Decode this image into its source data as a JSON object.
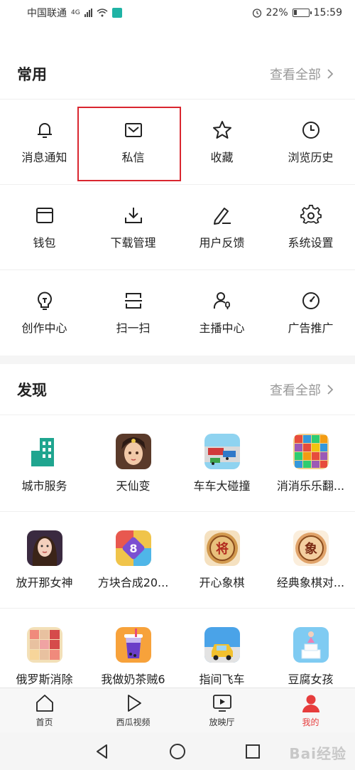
{
  "status_bar": {
    "carrier": "中国联通",
    "network": "4G",
    "battery": "22%",
    "battery_fraction": 0.22,
    "time": "15:59"
  },
  "common": {
    "title": "常用",
    "see_all": "查看全部",
    "rows": [
      [
        {
          "label": "消息通知",
          "icon": "bell-icon"
        },
        {
          "label": "私信",
          "icon": "mail-icon"
        },
        {
          "label": "收藏",
          "icon": "star-icon"
        },
        {
          "label": "浏览历史",
          "icon": "clock-icon"
        }
      ],
      [
        {
          "label": "钱包",
          "icon": "wallet-icon"
        },
        {
          "label": "下载管理",
          "icon": "download-icon"
        },
        {
          "label": "用户反馈",
          "icon": "pen-icon"
        },
        {
          "label": "系统设置",
          "icon": "gear-icon"
        }
      ],
      [
        {
          "label": "创作中心",
          "icon": "bulb-icon"
        },
        {
          "label": "扫一扫",
          "icon": "scan-icon"
        },
        {
          "label": "主播中心",
          "icon": "anchor-user-icon"
        },
        {
          "label": "广告推广",
          "icon": "gauge-icon"
        }
      ]
    ]
  },
  "discover": {
    "title": "发现",
    "see_all": "查看全部",
    "rows": [
      [
        {
          "label": "城市服务",
          "icon": "city-building-icon"
        },
        {
          "label": "天仙变",
          "icon": "game-tianxianbian-icon"
        },
        {
          "label": "车车大碰撞",
          "icon": "game-car-crash-icon"
        },
        {
          "label": "消消乐乐翻...",
          "icon": "game-blocks-icon"
        }
      ],
      [
        {
          "label": "放开那女神",
          "icon": "game-goddess-icon"
        },
        {
          "label": "方块合成20...",
          "icon": "game-block-merge-icon"
        },
        {
          "label": "开心象棋",
          "icon": "game-chess-jiang-icon"
        },
        {
          "label": "经典象棋对...",
          "icon": "game-chess-xiang-icon"
        }
      ],
      [
        {
          "label": "俄罗斯消除",
          "icon": "game-tetris-icon"
        },
        {
          "label": "我做奶茶贼6",
          "icon": "game-milk-tea-icon"
        },
        {
          "label": "指间飞车",
          "icon": "game-taxi-icon"
        },
        {
          "label": "豆腐女孩",
          "icon": "game-tofu-girl-icon"
        }
      ]
    ]
  },
  "tabs": [
    {
      "label": "首页",
      "icon": "home-icon"
    },
    {
      "label": "西瓜视频",
      "icon": "play-icon"
    },
    {
      "label": "放映厅",
      "icon": "tv-icon"
    },
    {
      "label": "我的",
      "icon": "user-icon",
      "active": true
    }
  ],
  "colors": {
    "accent": "#e63d3d",
    "highlight": "#d9262f",
    "teal": "#1fb3a5"
  },
  "watermark": "Bai经验"
}
